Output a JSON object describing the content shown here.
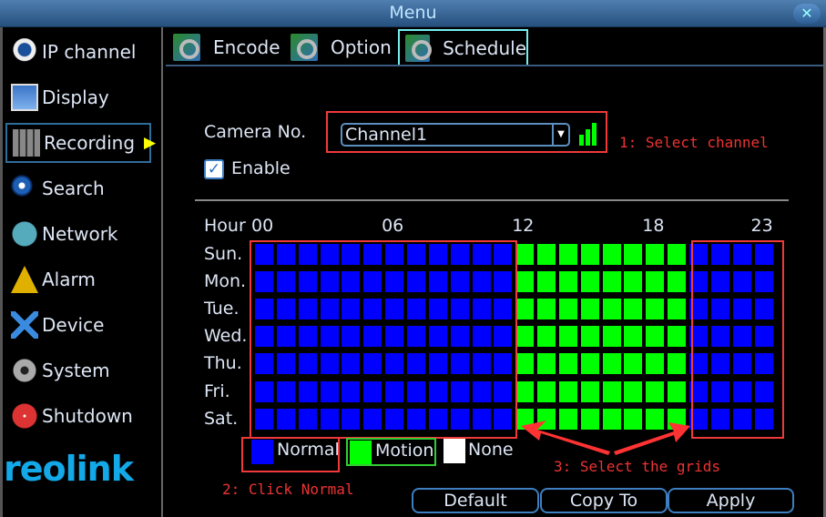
{
  "window": {
    "title": "Menu",
    "close_icon": "close-icon"
  },
  "sidebar": {
    "items": [
      {
        "label": "IP channel",
        "icon": "webcam-icon"
      },
      {
        "label": "Display",
        "icon": "display-icon"
      },
      {
        "label": "Recording",
        "icon": "film-gear-icon",
        "selected": true
      },
      {
        "label": "Search",
        "icon": "magnifier-icon"
      },
      {
        "label": "Network",
        "icon": "network-icon"
      },
      {
        "label": "Alarm",
        "icon": "warning-icon"
      },
      {
        "label": "Device",
        "icon": "tools-icon"
      },
      {
        "label": "System",
        "icon": "gear-icon"
      },
      {
        "label": "Shutdown",
        "icon": "power-icon"
      }
    ],
    "logo": "reolink"
  },
  "tabs": [
    {
      "label": "Encode"
    },
    {
      "label": "Option"
    },
    {
      "label": "Schedule",
      "selected": true
    }
  ],
  "form": {
    "camera_label": "Camera No.",
    "camera_value": "Channel1",
    "enable_label": "Enable",
    "enable_checked": true
  },
  "schedule": {
    "hour_label": "Hour",
    "hour_ticks": [
      "00",
      "06",
      "12",
      "18",
      "23"
    ],
    "days": [
      "Sun.",
      "Mon.",
      "Tue.",
      "Wed.",
      "Thu.",
      "Fri.",
      "Sat."
    ],
    "modes": [
      "N",
      "N",
      "N",
      "N",
      "N",
      "N",
      "N",
      "N",
      "N",
      "N",
      "N",
      "N",
      "M",
      "M",
      "M",
      "M",
      "M",
      "M",
      "M",
      "M",
      "N",
      "N",
      "N",
      "N"
    ],
    "colors": {
      "N": "#0000ff",
      "M": "#00ff00",
      "None": "#ffffff"
    }
  },
  "legend": {
    "normal": "Normal",
    "motion": "Motion",
    "none": "None"
  },
  "annotations": {
    "step1": "1: Select channel",
    "step2": "2: Click Normal",
    "step3": "3: Select the grids"
  },
  "buttons": {
    "default": "Default",
    "copy_to": "Copy To",
    "apply": "Apply"
  }
}
